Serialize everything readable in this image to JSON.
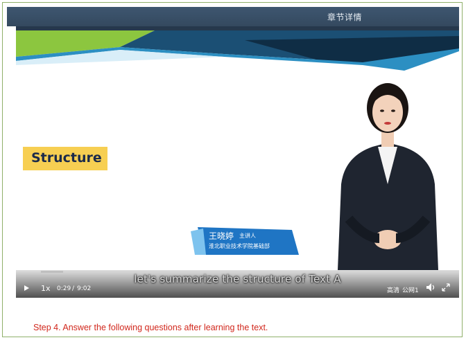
{
  "header": {
    "title": "章节详情"
  },
  "slide": {
    "heading": "Structure",
    "presenter_name": "王晓婷",
    "presenter_role": "主讲人",
    "presenter_dept": "淮北职业技术学院基础部"
  },
  "player": {
    "subtitle": "let's summarize the structure of  Text A",
    "speed": "1x",
    "current_time": "0:29",
    "time_separator": "/",
    "duration": "9:02",
    "quality": "高清",
    "network": "公网1",
    "progress_fraction": 0.053
  },
  "main": {
    "instruction": "Step 4. Answer the following questions after learning the text."
  },
  "colors": {
    "accent_red": "#d1271c",
    "header_bg": "#3a5068",
    "slide_yellow": "#f7cf52"
  }
}
